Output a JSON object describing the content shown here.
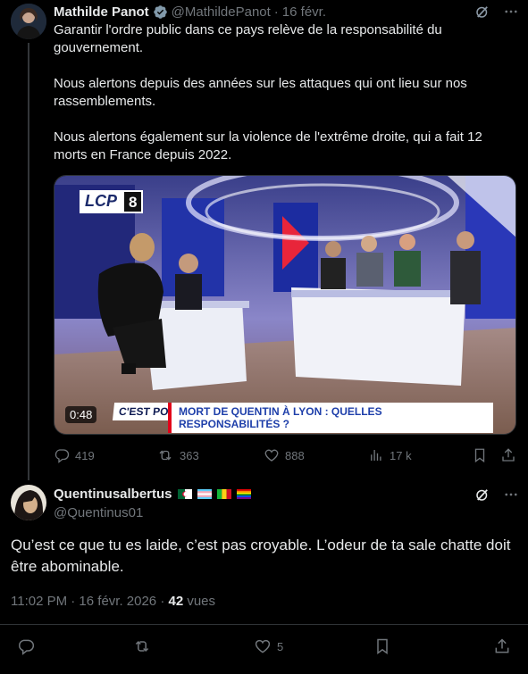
{
  "parent_tweet": {
    "author_name": "Mathilde Panot",
    "handle": "@MathildePanot",
    "date": "16 févr.",
    "text": [
      "Garantir l'ordre public dans ce pays relève de la responsabilité du gouvernement.",
      "Nous alertons depuis des années sur les attaques qui ont lieu sur nos rassemblements.",
      "Nous alertons également sur la violence de l'extrême droite, qui a fait 12 morts en France depuis 2022."
    ],
    "video": {
      "channel_logo": "LCP",
      "channel_number": "8",
      "duration": "0:48",
      "show_tag": "C'EST POLITIQUE",
      "headline": "MORT DE QUENTIN À LYON : QUELLES RESPONSABILITÉS ?"
    },
    "stats": {
      "replies": "419",
      "reposts": "363",
      "likes": "888",
      "views": "17 k"
    }
  },
  "reply_tweet": {
    "author_name": "Quentinusalbertus",
    "handle": "@Quentinus01",
    "text": "Qu’est ce que tu es laide, c’est pas croyable. L’odeur de ta sale chatte doit être abominable.",
    "time": "11:02 PM · 16 févr. 2026 · ",
    "views_count": "42",
    "views_label": " vues",
    "likes": "5"
  },
  "colors": {
    "background": "#000000",
    "text": "#e7e9ea",
    "muted": "#71767b",
    "verified": "#829aab",
    "divider": "#2f3336"
  },
  "icons": [
    "verified-icon",
    "grok-icon",
    "more-icon",
    "reply-icon",
    "repost-icon",
    "like-icon",
    "views-icon",
    "bookmark-icon",
    "share-icon"
  ]
}
